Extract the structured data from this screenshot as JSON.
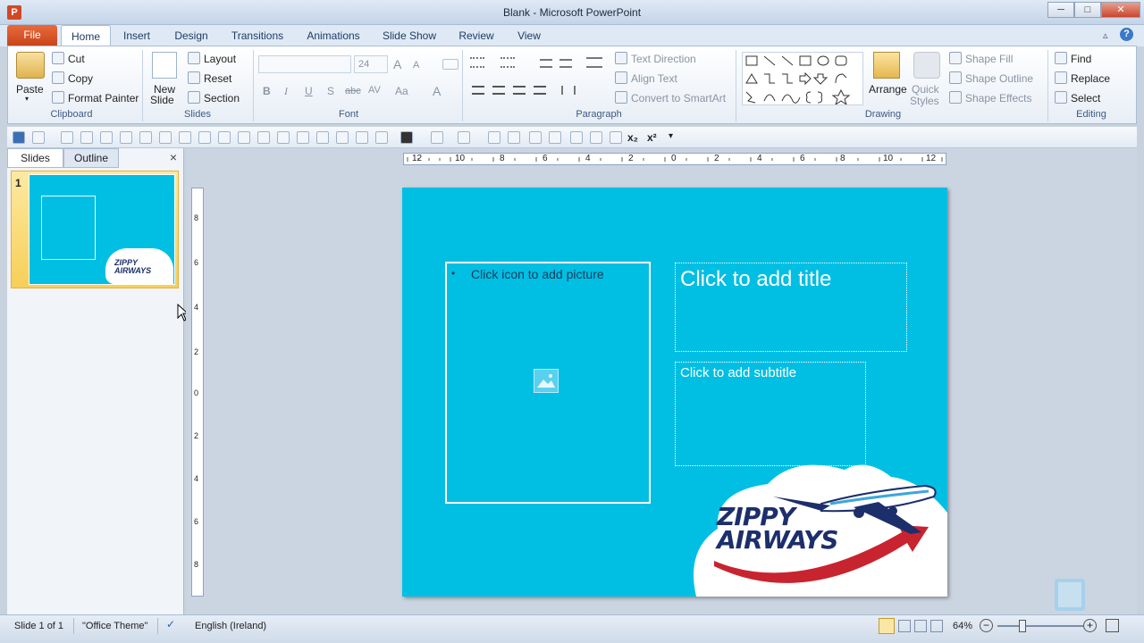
{
  "window": {
    "title": "Blank - Microsoft PowerPoint",
    "app_icon": "P"
  },
  "window_controls": {
    "minimize": "─",
    "maximize": "□",
    "close": "✕"
  },
  "tabs": {
    "file": "File",
    "items": [
      "Home",
      "Insert",
      "Design",
      "Transitions",
      "Animations",
      "Slide Show",
      "Review",
      "View"
    ]
  },
  "ribbon": {
    "clipboard": {
      "paste": "Paste",
      "cut": "Cut",
      "copy": "Copy",
      "format_painter": "Format Painter",
      "label": "Clipboard"
    },
    "slides": {
      "new_slide_1": "New",
      "new_slide_2": "Slide",
      "layout": "Layout",
      "reset": "Reset",
      "section": "Section",
      "label": "Slides"
    },
    "font": {
      "font_size": "24",
      "label": "Font",
      "bold": "B",
      "italic": "I",
      "underline": "U",
      "shadow": "S",
      "strike": "abc",
      "spacing": "AV",
      "case": "Aa",
      "color": "A",
      "grow": "A",
      "shrink": "A"
    },
    "paragraph": {
      "text_direction": "Text Direction",
      "align_text": "Align Text",
      "convert_smartart": "Convert to SmartArt",
      "label": "Paragraph"
    },
    "drawing": {
      "arrange": "Arrange",
      "quick_styles_1": "Quick",
      "quick_styles_2": "Styles",
      "shape_fill": "Shape Fill",
      "shape_outline": "Shape Outline",
      "shape_effects": "Shape Effects",
      "label": "Drawing"
    },
    "editing": {
      "find": "Find",
      "replace": "Replace",
      "select": "Select",
      "label": "Editing"
    }
  },
  "left_pane": {
    "tab_slides": "Slides",
    "tab_outline": "Outline",
    "close": "×",
    "slide_number": "1"
  },
  "rulers": {
    "horizontal": [
      "12",
      "10",
      "8",
      "6",
      "4",
      "2",
      "0",
      "2",
      "4",
      "6",
      "8",
      "10",
      "12"
    ],
    "vertical": [
      "8",
      "6",
      "4",
      "2",
      "0",
      "2",
      "4",
      "6",
      "8"
    ]
  },
  "slide": {
    "picture_placeholder": "Click icon to add picture",
    "bullet": "•",
    "title_placeholder": "Click to add title",
    "subtitle_placeholder": "Click to add subtitle",
    "logo_line1": "ZIPPY",
    "logo_line2": "AIRWAYS"
  },
  "status_bar": {
    "slide_info": "Slide 1 of 1",
    "theme": "\"Office Theme\"",
    "language": "English (Ireland)",
    "zoom": "64%"
  },
  "colors": {
    "slide_bg": "#00bfe3",
    "file_tab": "#d24726",
    "logo_red": "#c8242f",
    "logo_navy": "#1c2f6b"
  }
}
